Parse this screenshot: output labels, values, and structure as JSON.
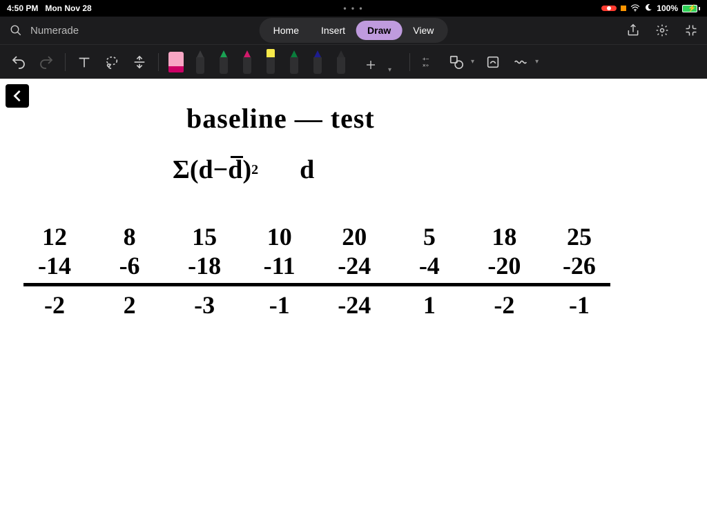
{
  "status": {
    "time": "4:50 PM",
    "date": "Mon Nov 28",
    "ellipsis": "• • •",
    "battery_pct": "100%"
  },
  "titlebar": {
    "search_placeholder": "Numerade"
  },
  "tabs": {
    "home": "Home",
    "insert": "Insert",
    "draw": "Draw",
    "view": "View",
    "active": "draw"
  },
  "pens": {
    "colors": [
      "#3a3a3c",
      "#1aa153",
      "#d11a6b",
      "#f7e94a",
      "#0a7d3c",
      "#1d1d8f",
      "#2c2c2e"
    ]
  },
  "handwriting": {
    "headline": "baseline — test",
    "formula_left": "Σ(d−d̄)",
    "formula_exp": "2",
    "formula_right": "d",
    "row1": [
      "12",
      "8",
      "15",
      "10",
      "20",
      "5",
      "18",
      "25"
    ],
    "row2": [
      "-14",
      "-6",
      "-18",
      "-11",
      "-24",
      "-4",
      "-20",
      "-26"
    ],
    "row3": [
      "-2",
      "2",
      "-3",
      "-1",
      "-24",
      "1",
      "-2",
      "-1"
    ]
  }
}
